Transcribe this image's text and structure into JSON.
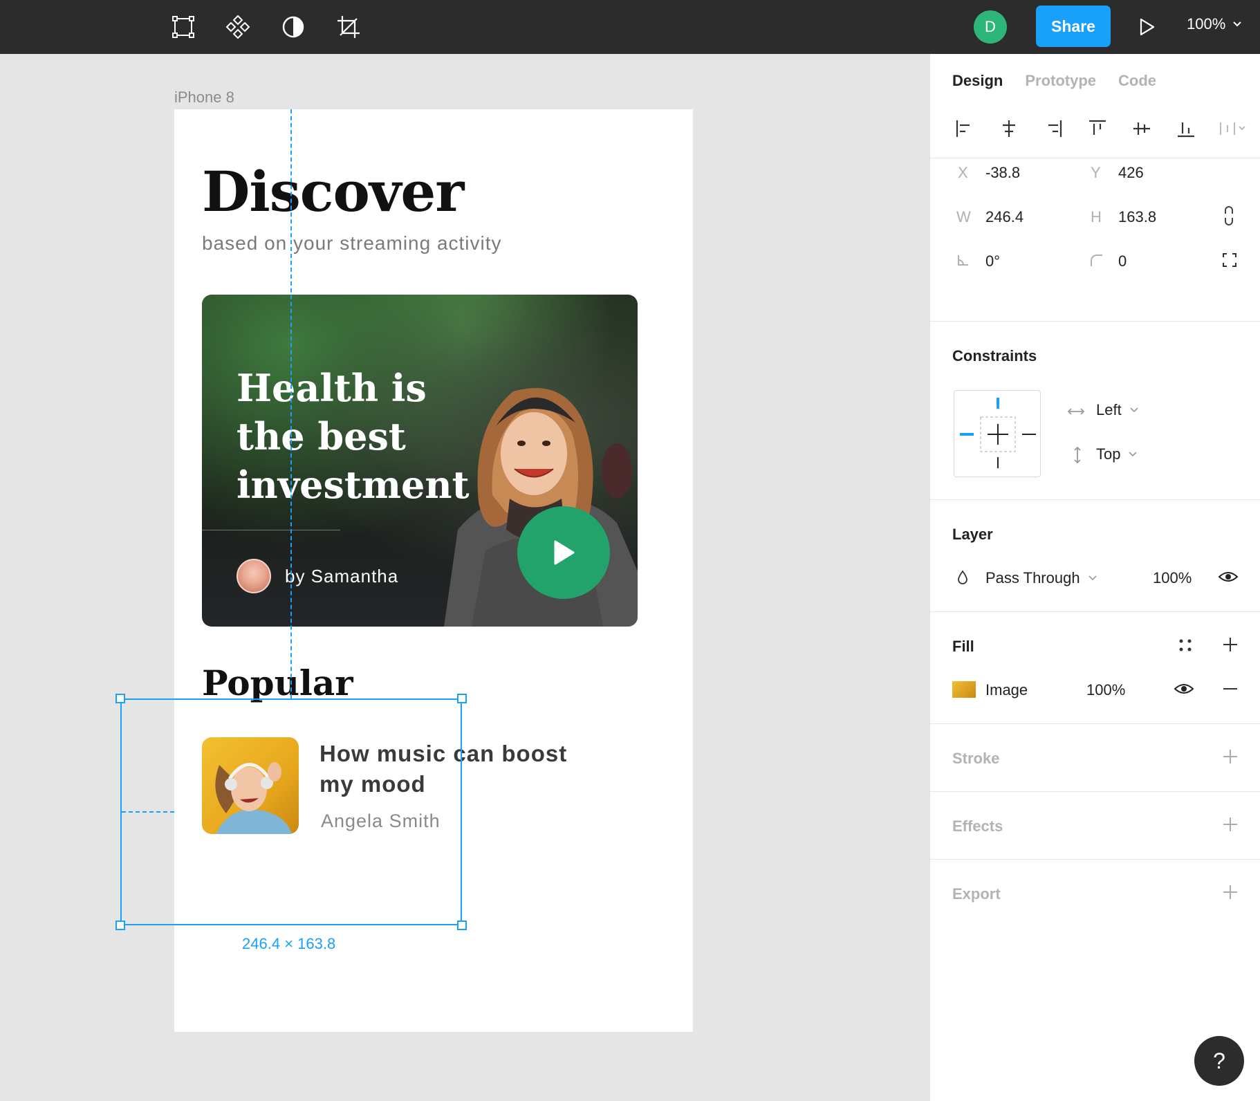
{
  "toolbar": {
    "tools": [
      "frame-icon",
      "component-icon",
      "contrast-icon",
      "crop-icon"
    ],
    "user_initial": "D",
    "share_label": "Share",
    "zoom": "100%"
  },
  "canvas": {
    "frame_label": "iPhone 8",
    "discover_title": "Discover",
    "discover_subtitle": "based on your streaming activity",
    "hero": {
      "title": "Health is the best investment",
      "author": "by Samantha"
    },
    "popular_title": "Popular",
    "popular_item": {
      "title": "How music can boost my mood",
      "author": "Angela Smith"
    },
    "selection_dimensions": "246.4 × 163.8"
  },
  "panel": {
    "tabs": [
      "Design",
      "Prototype",
      "Code"
    ],
    "x_label": "X",
    "x_value": "-38.8",
    "y_label": "Y",
    "y_value": "426",
    "w_label": "W",
    "w_value": "246.4",
    "h_label": "H",
    "h_value": "163.8",
    "rotation": "0°",
    "radius": "0",
    "constraints_title": "Constraints",
    "constraint_horizontal": "Left",
    "constraint_vertical": "Top",
    "layer_title": "Layer",
    "blend_mode": "Pass Through",
    "layer_opacity": "100%",
    "fill_title": "Fill",
    "fill_type": "Image",
    "fill_opacity": "100%",
    "stroke_title": "Stroke",
    "effects_title": "Effects",
    "export_title": "Export"
  },
  "help_label": "?",
  "colors": {
    "toolbar_bg": "#2c2c2c",
    "accent_blue": "#18a0fb",
    "avatar_green": "#2db678",
    "play_green": "#23a36c",
    "canvas_bg": "#e5e5e5"
  }
}
